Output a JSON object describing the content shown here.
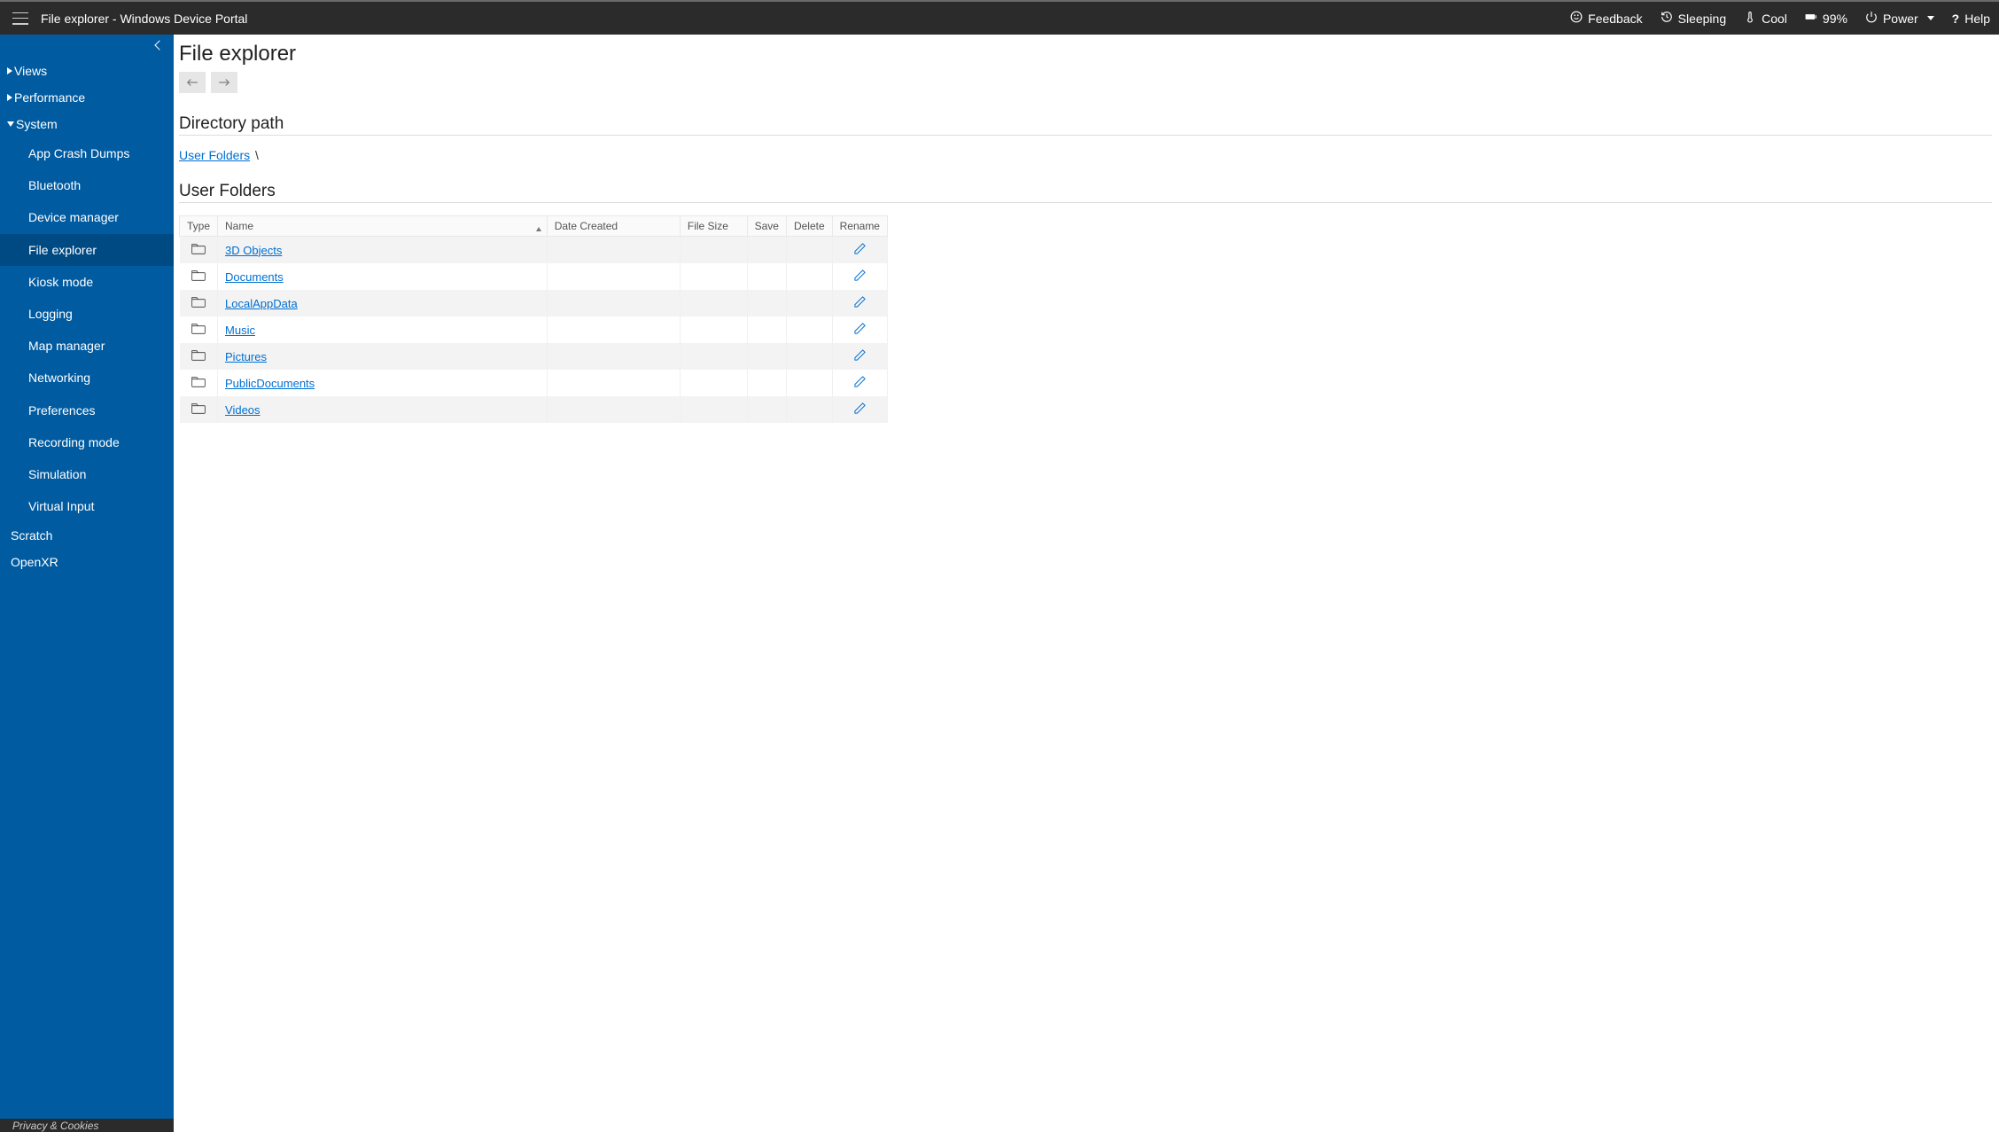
{
  "header": {
    "title": "File explorer - Windows Device Portal",
    "feedback": "Feedback",
    "sleeping": "Sleeping",
    "cool": "Cool",
    "battery": "99%",
    "power": "Power",
    "help": "Help"
  },
  "sidebar": {
    "groups": [
      {
        "label": "Views",
        "open": false
      },
      {
        "label": "Performance",
        "open": false
      },
      {
        "label": "System",
        "open": true
      }
    ],
    "systemItems": [
      "App Crash Dumps",
      "Bluetooth",
      "Device manager",
      "File explorer",
      "Kiosk mode",
      "Logging",
      "Map manager",
      "Networking",
      "Preferences",
      "Recording mode",
      "Simulation",
      "Virtual Input"
    ],
    "activeIndex": 3,
    "after": [
      "Scratch",
      "OpenXR"
    ],
    "footer": "Privacy & Cookies"
  },
  "main": {
    "pageTitle": "File explorer",
    "dirPathLabel": "Directory path",
    "crumbRoot": "User Folders",
    "crumbSep": "\\",
    "listingTitle": "User Folders",
    "cols": {
      "type": "Type",
      "name": "Name",
      "date": "Date Created",
      "size": "File Size",
      "save": "Save",
      "delete": "Delete",
      "rename": "Rename"
    },
    "rows": [
      {
        "name": "3D Objects"
      },
      {
        "name": "Documents"
      },
      {
        "name": "LocalAppData"
      },
      {
        "name": "Music"
      },
      {
        "name": "Pictures"
      },
      {
        "name": "PublicDocuments"
      },
      {
        "name": "Videos"
      }
    ]
  }
}
